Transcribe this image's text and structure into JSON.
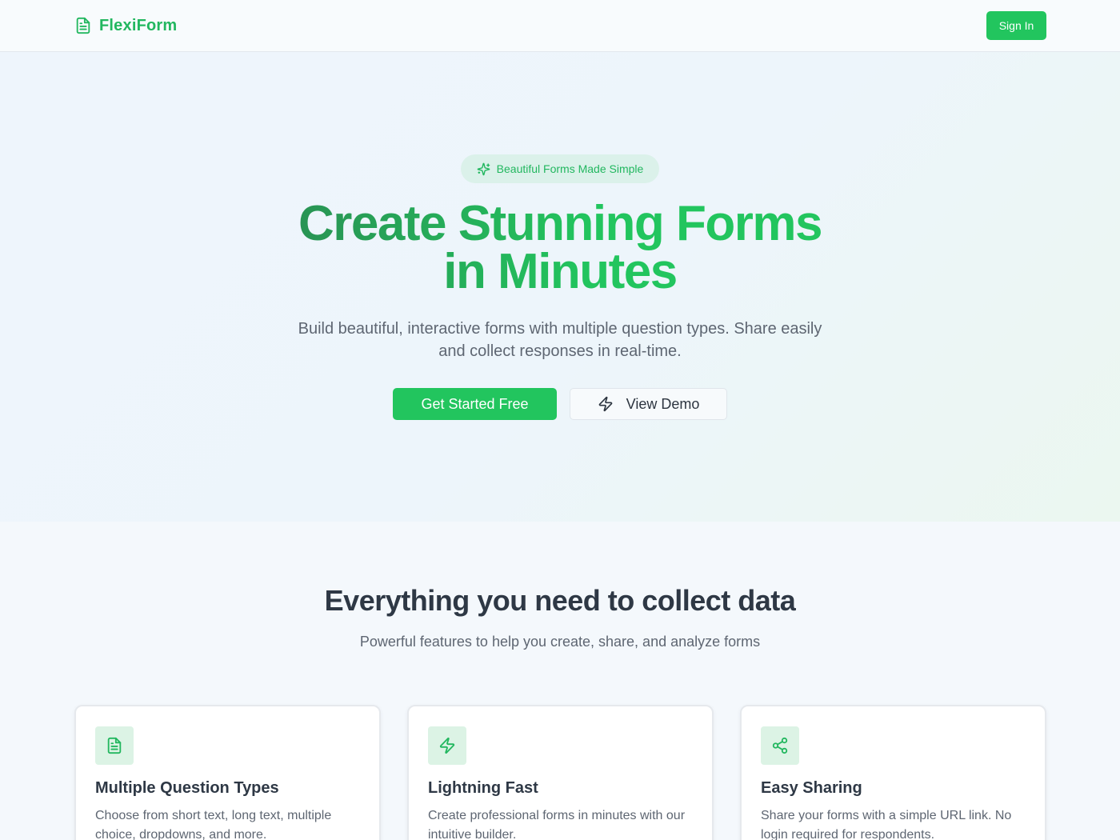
{
  "header": {
    "brand": "FlexiForm",
    "brand_icon": "document-icon",
    "sign_in": "Sign In"
  },
  "hero": {
    "badge_icon": "sparkles-icon",
    "badge": "Beautiful Forms Made Simple",
    "title_line1": "Create Stunning Forms",
    "title_line2": "in Minutes",
    "subtitle": "Build beautiful, interactive forms with multiple question types. Share easily and collect responses in real-time.",
    "primary_cta": "Get Started Free",
    "secondary_cta": "View Demo",
    "secondary_icon": "lightning-icon"
  },
  "features": {
    "title": "Everything you need to collect data",
    "subtitle": "Powerful features to help you create, share, and analyze forms",
    "cards": [
      {
        "icon": "document-icon",
        "title": "Multiple Question Types",
        "desc": "Choose from short text, long text, multiple choice, dropdowns, and more."
      },
      {
        "icon": "lightning-icon",
        "title": "Lightning Fast",
        "desc": "Create professional forms in minutes with our intuitive builder."
      },
      {
        "icon": "share-icon",
        "title": "Easy Sharing",
        "desc": "Share your forms with a simple URL link. No login required for respondents."
      }
    ]
  },
  "colors": {
    "accent": "#22c55e",
    "accent_dark": "#2a8a52",
    "icon_bg": "#dcf3e5",
    "badge_bg": "#dbf1ea"
  }
}
